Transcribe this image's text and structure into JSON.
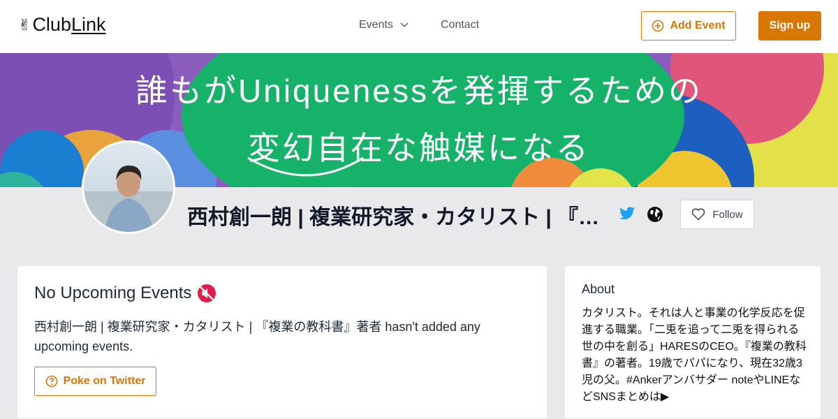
{
  "header": {
    "logo_main": "Club",
    "logo_link": "Link",
    "nav_events": "Events",
    "nav_contact": "Contact",
    "add_event": "Add Event",
    "sign_up": "Sign up"
  },
  "banner": {
    "line1": "誰もがUniquenessを発揮するための",
    "line2": "変幻自在な触媒になる"
  },
  "profile": {
    "name": "西村創一朗 | 複業研究家・カタリスト | 『複業の教科書』著者",
    "follow": "Follow"
  },
  "events_card": {
    "title": "No Upcoming Events",
    "description": "西村創一朗 | 複業研究家・カタリスト | 『複業の教科書』著者 hasn't added any upcoming events.",
    "poke_button": "Poke on Twitter"
  },
  "about_card": {
    "title": "About",
    "text": "カタリスト。それは人と事業の化学反応を促進する職業。「二兎を追って二兎を得られる世の中を創る」HARESのCEO。『複業の教科書』の著者。19歳でパパになり、現在32歳3児の父。#Ankerアンバサダー noteやLINEなどSNSまとめは▶"
  },
  "colors": {
    "accent": "#d97706",
    "twitter": "#1da1f2",
    "banner_green": "#17b26a"
  }
}
